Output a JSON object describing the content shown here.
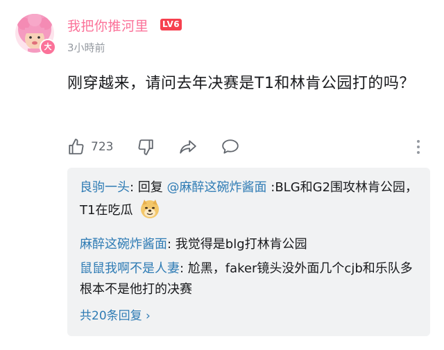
{
  "comment": {
    "author": "我把你推河里",
    "avatar_badge": "大",
    "level": "LV6",
    "time": "3小時前",
    "content": "刚穿越来，请问去年决赛是T1和林肯公园打的吗？"
  },
  "actions": {
    "like_count": "723",
    "icons": [
      "thumb-up-icon",
      "thumb-down-icon",
      "share-icon",
      "comment-icon",
      "more-icon"
    ]
  },
  "replies": [
    {
      "name": "良驹一头",
      "colon": ": ",
      "text_prefix": "回复 ",
      "mention": "@麻醉这碗炸酱面",
      "text": " :BLG和G2围攻林肯公园，T1在吃瓜",
      "emoji": "doge-emoji"
    },
    {
      "name": "麻醉这碗炸酱面",
      "colon": ": ",
      "text": "我觉得是blg打林肯公园"
    },
    {
      "name": "鼠鼠我啊不是人妻",
      "colon": ": ",
      "text": "尬黑，faker镜头没外面几个cjb和乐队多根本不是他打的决赛"
    }
  ],
  "more_replies": "共20条回复 ›",
  "colors": {
    "accent_pink": "#fb7299",
    "level_red": "#f6404f",
    "link_blue": "#2e7bb4",
    "gray": "#9499a0"
  }
}
